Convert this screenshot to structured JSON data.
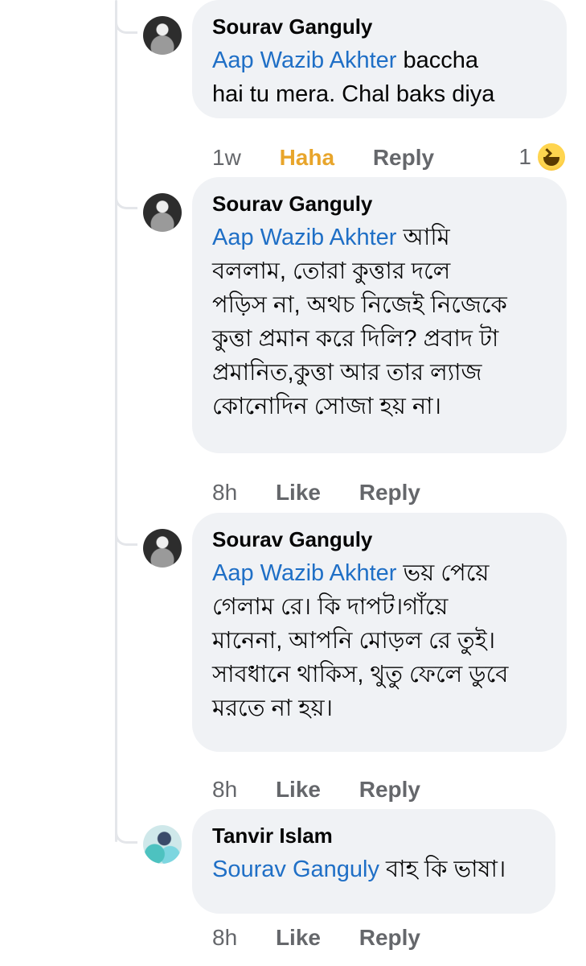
{
  "comments": [
    {
      "author": "Sourav Ganguly",
      "mention": "Aap Wazib Akhter",
      "lines": [
        " baccha",
        "hai tu mera. Chal baks diya"
      ],
      "time": "1w",
      "action1": "Haha",
      "reply": "Reply",
      "reaction_count": "1",
      "reaction_icon": "haha-emoji-icon"
    },
    {
      "author": "Sourav Ganguly",
      "mention": "Aap Wazib Akhter",
      "lines": [
        " আমি",
        "বললাম, তোরা কুত্তার দলে",
        "পড়িস না, অথচ নিজেই নিজেকে",
        "কুত্তা প্রমান করে দিলি? প্রবাদ টা",
        "প্রমানিত,কুত্তা আর তার ল্যাজ",
        "কোনোদিন সোজা হয় না।"
      ],
      "time": "8h",
      "action1": "Like",
      "reply": "Reply"
    },
    {
      "author": "Sourav Ganguly",
      "mention": "Aap Wazib Akhter",
      "lines": [
        " ভয় পেয়ে",
        "গেলাম রে। কি দাপট।গাঁয়ে",
        "মানেনা, আপনি মোড়ল রে তুই।",
        "সাবধানে থাকিস, থুতু ফেলে ডুবে",
        "মরতে না হয়।"
      ],
      "time": "8h",
      "action1": "Like",
      "reply": "Reply"
    },
    {
      "author": "Tanvir Islam",
      "mention": "Sourav Ganguly",
      "lines": [
        " বাহ কি ভাষা।"
      ],
      "time": "8h",
      "action1": "Like",
      "reply": "Reply"
    }
  ]
}
